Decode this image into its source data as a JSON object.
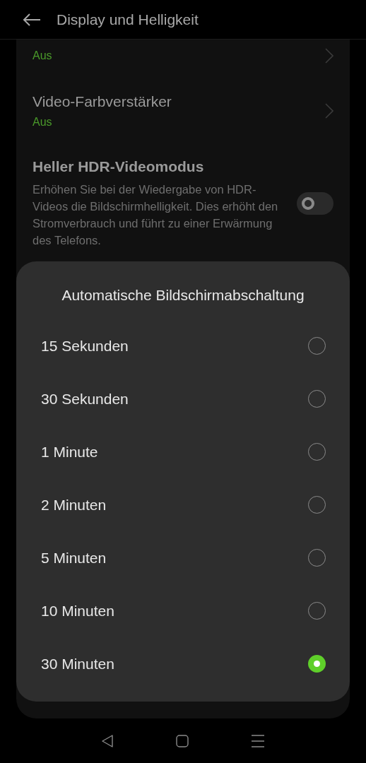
{
  "header": {
    "title": "Display und Helligkeit"
  },
  "settings": [
    {
      "kind": "link",
      "value": "Aus"
    },
    {
      "kind": "link",
      "title": "Video-Farbverstärker",
      "value": "Aus"
    },
    {
      "kind": "toggle",
      "title": "Heller HDR-Videomodus",
      "description": "Erhöhen Sie bei der Wiedergabe von HDR-Videos die Bildschirmhelligkeit. Dies erhöht den Stromverbrauch und führt zu einer Erwärmung des Telefons.",
      "on": false
    }
  ],
  "dialog": {
    "title": "Automatische Bildschirmabschaltung",
    "options": [
      {
        "label": "15 Sekunden",
        "selected": false
      },
      {
        "label": "30 Sekunden",
        "selected": false
      },
      {
        "label": "1 Minute",
        "selected": false
      },
      {
        "label": "2 Minuten",
        "selected": false
      },
      {
        "label": "5 Minuten",
        "selected": false
      },
      {
        "label": "10 Minuten",
        "selected": false
      },
      {
        "label": "30 Minuten",
        "selected": true
      }
    ]
  }
}
